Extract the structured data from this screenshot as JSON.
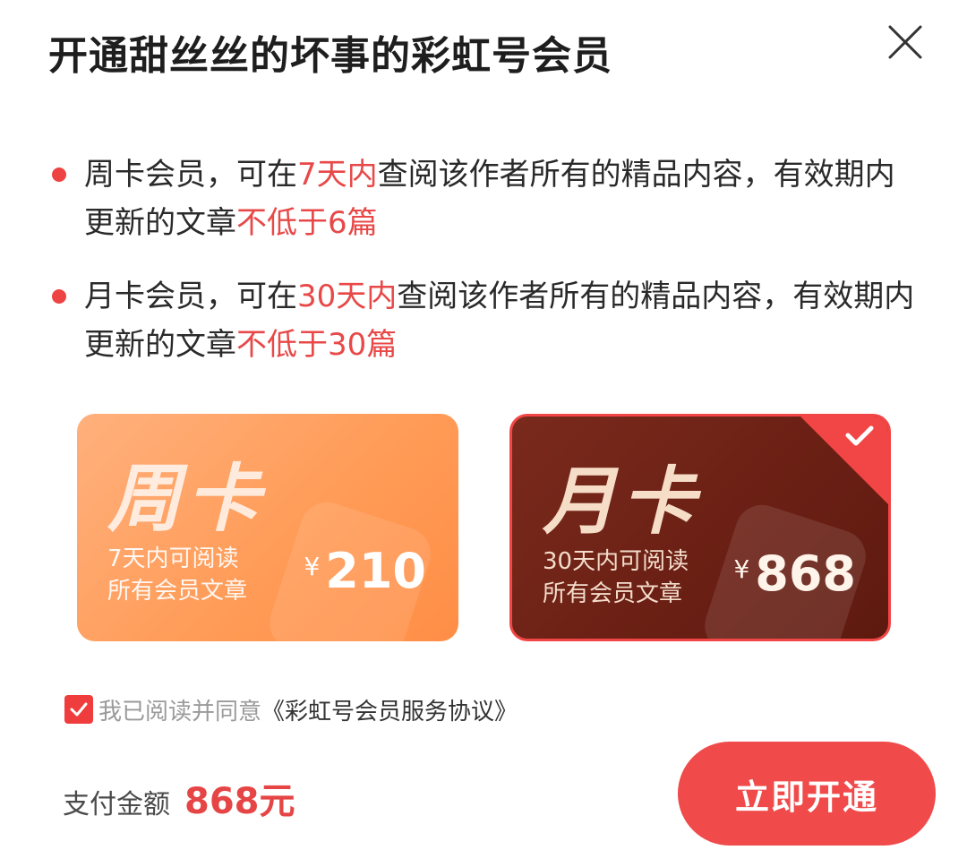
{
  "header": {
    "title": "开通甜丝丝的坏事的彩虹号会员"
  },
  "benefits": [
    {
      "pre": "周卡会员，可在",
      "hl1": "7天内",
      "mid": "查阅该作者所有的精品内容，有效期内更新的文章",
      "hl2": "不低于6篇"
    },
    {
      "pre": "月卡会员，可在",
      "hl1": "30天内",
      "mid": "查阅该作者所有的精品内容，有效期内更新的文章",
      "hl2": "不低于30篇"
    }
  ],
  "cards": [
    {
      "name": "周卡",
      "desc_line1": "7天内可阅读",
      "desc_line2": "所有会员文章",
      "currency": "¥",
      "price": "210",
      "selected": false
    },
    {
      "name": "月卡",
      "desc_line1": "30天内可阅读",
      "desc_line2": "所有会员文章",
      "currency": "¥",
      "price": "868",
      "selected": true
    }
  ],
  "agreement": {
    "checked": true,
    "text": "我已阅读并同意",
    "link": "《彩虹号会员服务协议》"
  },
  "payment": {
    "label": "支付金额",
    "amount": "868元"
  },
  "submit_label": "立即开通",
  "colors": {
    "accent": "#f04a4a",
    "week_card": "#ff9c58",
    "month_card": "#6a1f14"
  }
}
